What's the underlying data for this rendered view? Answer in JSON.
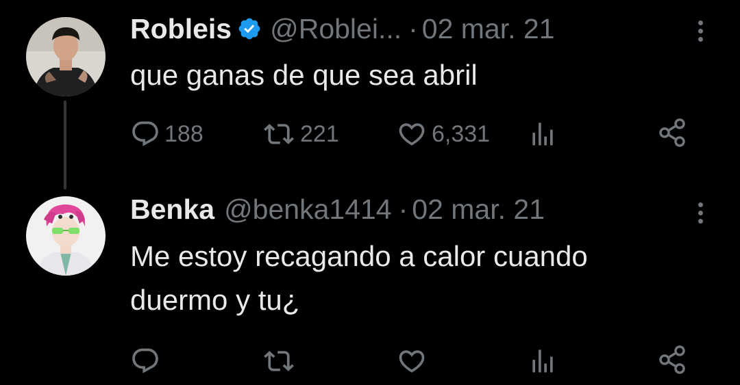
{
  "tweets": [
    {
      "name": "Robleis",
      "handle": "@Roblei...",
      "separator": "·",
      "date": "02 mar. 21",
      "text": "que ganas de que sea abril",
      "replies": "188",
      "retweets": "221",
      "likes": "6,331",
      "verified": true
    },
    {
      "name": "Benka",
      "handle": "@benka1414",
      "separator": "·",
      "date": "02 mar. 21",
      "text_lines": [
        "Me estoy recagando a calor cuando",
        "duermo y tu¿"
      ],
      "verified": false
    }
  ],
  "icons": {
    "reply": "reply-icon",
    "retweet": "retweet-icon",
    "like": "heart-icon",
    "views": "views-icon",
    "share": "share-icon",
    "more": "more-icon",
    "verified": "verified-badge-icon"
  },
  "colors": {
    "background": "#000000",
    "text": "#e7e9ea",
    "muted": "#71767b",
    "verified": "#1d9bf0",
    "thread_line": "#333639"
  }
}
